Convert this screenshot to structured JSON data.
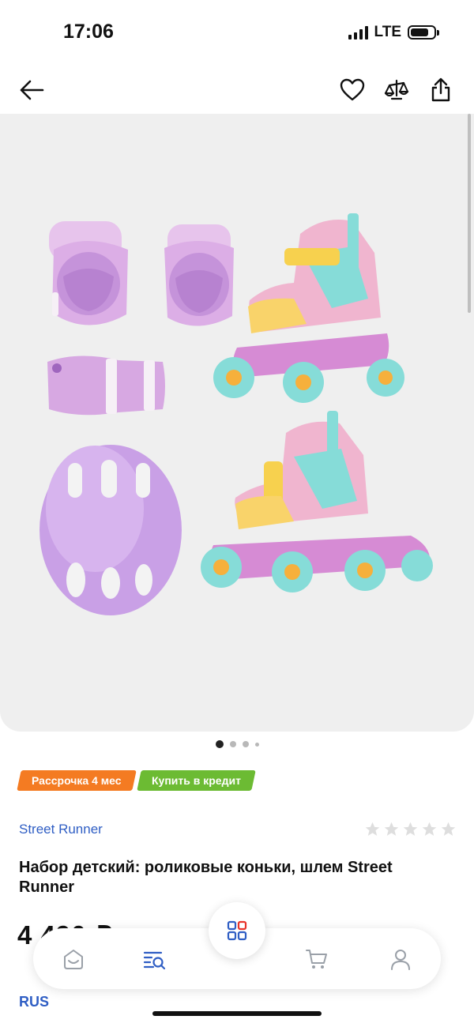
{
  "status": {
    "time": "17:06",
    "network": "LTE"
  },
  "nav": {
    "back_icon": "arrow-left-icon",
    "favorite_icon": "heart-icon",
    "compare_icon": "scales-icon",
    "share_icon": "share-icon"
  },
  "gallery": {
    "page_count": 4,
    "active_index": 0
  },
  "badges": {
    "installment": "Рассрочка 4 мес",
    "credit": "Купить в кредит"
  },
  "product": {
    "brand": "Street Runner",
    "rating": 0,
    "rating_max": 5,
    "title": "Набор детский: роликовые коньки, шлем Street Runner",
    "price": "4 490 ₽"
  },
  "region": "RUS",
  "tabbar": {
    "items": [
      "home-icon",
      "catalog-search-icon",
      "apps-grid-icon",
      "cart-icon",
      "profile-icon"
    ]
  },
  "colors": {
    "accent_blue": "#2f5ec4",
    "orange": "#f47b22",
    "green": "#6cbb33",
    "lilac": "#c99be0",
    "mint": "#7fdcd6"
  }
}
